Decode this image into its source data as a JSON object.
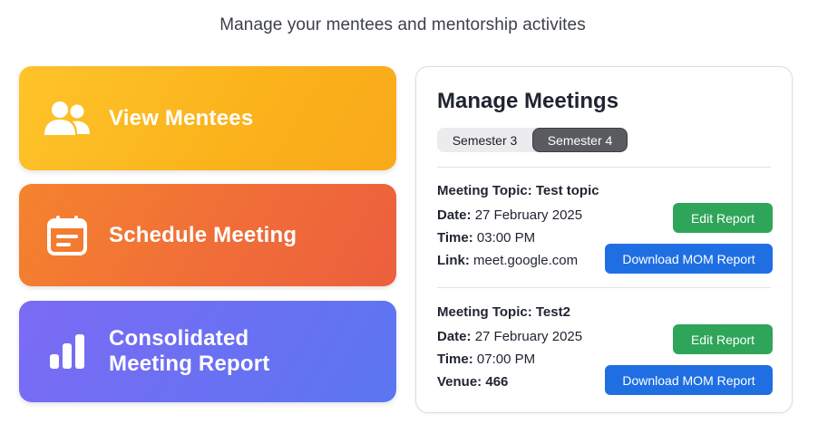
{
  "header": {
    "subtitle": "Manage your mentees and mentorship activites"
  },
  "actions": [
    {
      "label": "View Mentees",
      "icon": "users-icon",
      "color": "#fbb21b"
    },
    {
      "label": "Schedule Meeting",
      "icon": "calendar-icon",
      "color": "#f06d38"
    },
    {
      "label_line1": "Consolidated",
      "label_line2": "Meeting Report",
      "icon": "bar-chart-icon",
      "color": "#6b70f3"
    }
  ],
  "meetings_panel": {
    "title": "Manage Meetings",
    "tabs": [
      {
        "label": "Semester 3",
        "active": false
      },
      {
        "label": "Semester 4",
        "active": true
      }
    ],
    "meetings": [
      {
        "topic": "Meeting Topic: Test topic",
        "date_label": "Date:",
        "date": "27 February 2025",
        "time_label": "Time:",
        "time": "03:00 PM",
        "extra_label": "Link:",
        "extra": "meet.google.com",
        "edit_label": "Edit Report",
        "download_label": "Download MOM Report"
      },
      {
        "topic": "Meeting Topic: Test2",
        "date_label": "Date:",
        "date": "27 February 2025",
        "time_label": "Time:",
        "time": "07:00 PM",
        "extra_label": "Venue:",
        "extra": "466",
        "edit_label": "Edit Report",
        "download_label": "Download MOM Report"
      }
    ]
  },
  "colors": {
    "edit_button": "#2fa55a",
    "download_button": "#1f6fe3",
    "active_tab": "#5a5b5e"
  }
}
